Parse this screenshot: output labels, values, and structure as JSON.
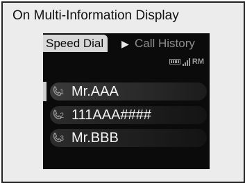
{
  "caption": "On Multi-Information Display",
  "tabs": {
    "active": "Speed Dial",
    "separator": "▶",
    "inactive": "Call History"
  },
  "status": {
    "battery_icon": "battery-icon",
    "signal_icon": "signal-strength-icon",
    "roaming": "RM"
  },
  "speed_dial": [
    {
      "index": "1",
      "name": "Mr.AAA",
      "icon": "phone-handset-icon"
    },
    {
      "index": "2",
      "name": "111AAA####",
      "icon": "phone-handset-icon"
    },
    {
      "index": "3",
      "name": "Mr.BBB",
      "icon": "phone-handset-icon"
    }
  ],
  "colors": {
    "screen_bg": "#0b0b0b",
    "tab_active_bg": "#d8d8d8",
    "tab_inactive_text": "#8e8e8e",
    "frame_bg": "#ececec"
  }
}
